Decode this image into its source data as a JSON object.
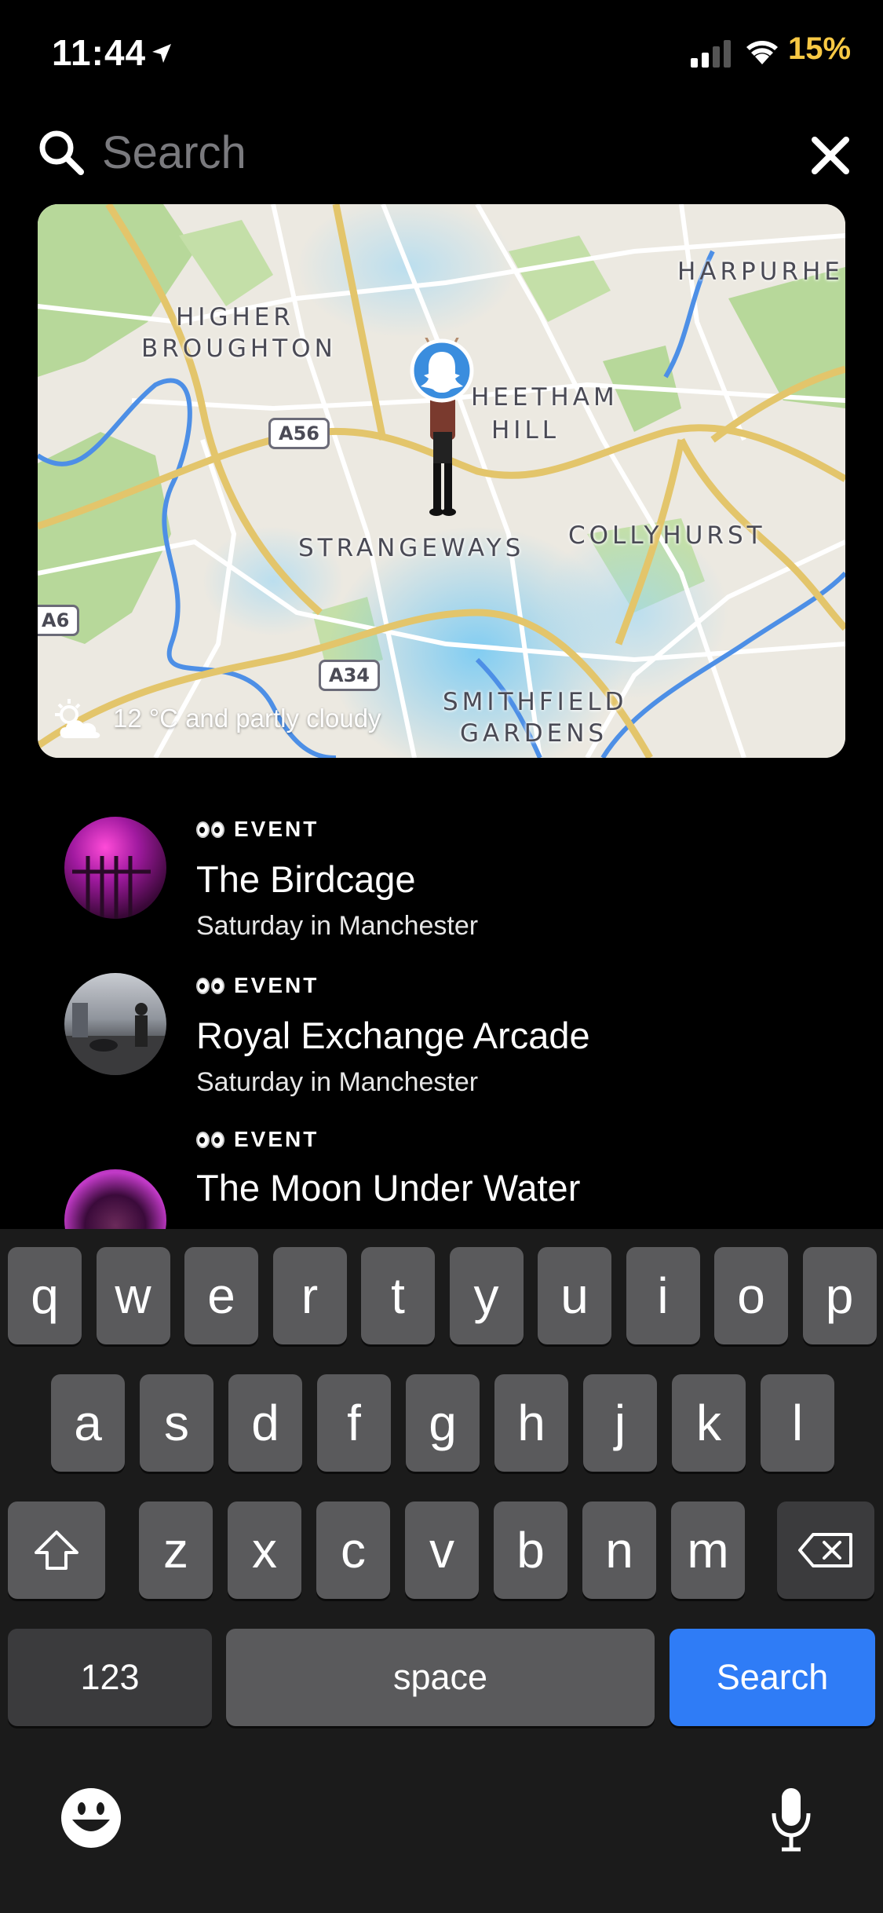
{
  "status_bar": {
    "time": "11:44",
    "battery": "15%"
  },
  "search": {
    "placeholder": "Search",
    "value": ""
  },
  "map": {
    "labels": {
      "harpurhey": "HARPURHE",
      "higher_broughton_1": "HIGHER",
      "higher_broughton_2": "BROUGHTON",
      "cheetham_1": "HEETHAM",
      "cheetham_2": "HILL",
      "strangeways": "STRANGEWAYS",
      "collyhurst": "COLLYHURST",
      "smithfield_1": "SMITHFIELD",
      "smithfield_2": "GARDENS"
    },
    "roads": {
      "a56": "A56",
      "a6": "A6",
      "a34": "A34"
    },
    "weather": "12 °C and partly cloudy",
    "colors": {
      "land": "#ece9e1",
      "park": "#a9d28a",
      "water": "#4d8fe6",
      "major_road": "#e3c56b",
      "heat": "#6fc8f5"
    }
  },
  "events": [
    {
      "tag": "EVENT",
      "title": "The Birdcage",
      "subtitle": "Saturday in Manchester"
    },
    {
      "tag": "EVENT",
      "title": "Royal Exchange Arcade",
      "subtitle": "Saturday in Manchester"
    },
    {
      "tag": "EVENT",
      "title": "The Moon Under Water",
      "subtitle": ""
    }
  ],
  "keyboard": {
    "row1": [
      "q",
      "w",
      "e",
      "r",
      "t",
      "y",
      "u",
      "i",
      "o",
      "p"
    ],
    "row2": [
      "a",
      "s",
      "d",
      "f",
      "g",
      "h",
      "j",
      "k",
      "l"
    ],
    "row3": [
      "z",
      "x",
      "c",
      "v",
      "b",
      "n",
      "m"
    ],
    "numbers_key": "123",
    "space_key": "space",
    "search_key": "Search",
    "colors": {
      "key": "#5a5a5c",
      "action": "#2f7cf6"
    }
  }
}
